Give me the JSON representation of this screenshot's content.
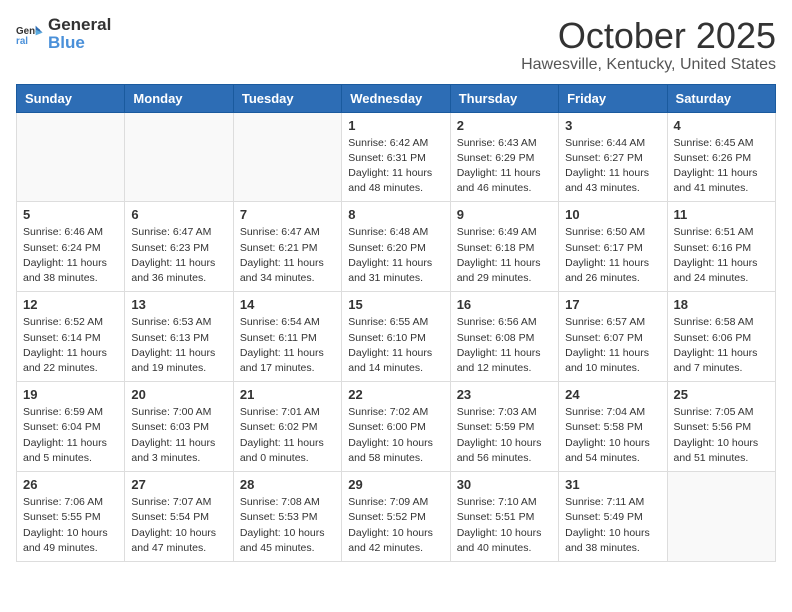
{
  "header": {
    "logo_general": "General",
    "logo_blue": "Blue",
    "month_title": "October 2025",
    "location": "Hawesville, Kentucky, United States"
  },
  "weekdays": [
    "Sunday",
    "Monday",
    "Tuesday",
    "Wednesday",
    "Thursday",
    "Friday",
    "Saturday"
  ],
  "weeks": [
    [
      {
        "day": "",
        "sunrise": "",
        "sunset": "",
        "daylight": ""
      },
      {
        "day": "",
        "sunrise": "",
        "sunset": "",
        "daylight": ""
      },
      {
        "day": "",
        "sunrise": "",
        "sunset": "",
        "daylight": ""
      },
      {
        "day": "1",
        "sunrise": "Sunrise: 6:42 AM",
        "sunset": "Sunset: 6:31 PM",
        "daylight": "Daylight: 11 hours and 48 minutes."
      },
      {
        "day": "2",
        "sunrise": "Sunrise: 6:43 AM",
        "sunset": "Sunset: 6:29 PM",
        "daylight": "Daylight: 11 hours and 46 minutes."
      },
      {
        "day": "3",
        "sunrise": "Sunrise: 6:44 AM",
        "sunset": "Sunset: 6:27 PM",
        "daylight": "Daylight: 11 hours and 43 minutes."
      },
      {
        "day": "4",
        "sunrise": "Sunrise: 6:45 AM",
        "sunset": "Sunset: 6:26 PM",
        "daylight": "Daylight: 11 hours and 41 minutes."
      }
    ],
    [
      {
        "day": "5",
        "sunrise": "Sunrise: 6:46 AM",
        "sunset": "Sunset: 6:24 PM",
        "daylight": "Daylight: 11 hours and 38 minutes."
      },
      {
        "day": "6",
        "sunrise": "Sunrise: 6:47 AM",
        "sunset": "Sunset: 6:23 PM",
        "daylight": "Daylight: 11 hours and 36 minutes."
      },
      {
        "day": "7",
        "sunrise": "Sunrise: 6:47 AM",
        "sunset": "Sunset: 6:21 PM",
        "daylight": "Daylight: 11 hours and 34 minutes."
      },
      {
        "day": "8",
        "sunrise": "Sunrise: 6:48 AM",
        "sunset": "Sunset: 6:20 PM",
        "daylight": "Daylight: 11 hours and 31 minutes."
      },
      {
        "day": "9",
        "sunrise": "Sunrise: 6:49 AM",
        "sunset": "Sunset: 6:18 PM",
        "daylight": "Daylight: 11 hours and 29 minutes."
      },
      {
        "day": "10",
        "sunrise": "Sunrise: 6:50 AM",
        "sunset": "Sunset: 6:17 PM",
        "daylight": "Daylight: 11 hours and 26 minutes."
      },
      {
        "day": "11",
        "sunrise": "Sunrise: 6:51 AM",
        "sunset": "Sunset: 6:16 PM",
        "daylight": "Daylight: 11 hours and 24 minutes."
      }
    ],
    [
      {
        "day": "12",
        "sunrise": "Sunrise: 6:52 AM",
        "sunset": "Sunset: 6:14 PM",
        "daylight": "Daylight: 11 hours and 22 minutes."
      },
      {
        "day": "13",
        "sunrise": "Sunrise: 6:53 AM",
        "sunset": "Sunset: 6:13 PM",
        "daylight": "Daylight: 11 hours and 19 minutes."
      },
      {
        "day": "14",
        "sunrise": "Sunrise: 6:54 AM",
        "sunset": "Sunset: 6:11 PM",
        "daylight": "Daylight: 11 hours and 17 minutes."
      },
      {
        "day": "15",
        "sunrise": "Sunrise: 6:55 AM",
        "sunset": "Sunset: 6:10 PM",
        "daylight": "Daylight: 11 hours and 14 minutes."
      },
      {
        "day": "16",
        "sunrise": "Sunrise: 6:56 AM",
        "sunset": "Sunset: 6:08 PM",
        "daylight": "Daylight: 11 hours and 12 minutes."
      },
      {
        "day": "17",
        "sunrise": "Sunrise: 6:57 AM",
        "sunset": "Sunset: 6:07 PM",
        "daylight": "Daylight: 11 hours and 10 minutes."
      },
      {
        "day": "18",
        "sunrise": "Sunrise: 6:58 AM",
        "sunset": "Sunset: 6:06 PM",
        "daylight": "Daylight: 11 hours and 7 minutes."
      }
    ],
    [
      {
        "day": "19",
        "sunrise": "Sunrise: 6:59 AM",
        "sunset": "Sunset: 6:04 PM",
        "daylight": "Daylight: 11 hours and 5 minutes."
      },
      {
        "day": "20",
        "sunrise": "Sunrise: 7:00 AM",
        "sunset": "Sunset: 6:03 PM",
        "daylight": "Daylight: 11 hours and 3 minutes."
      },
      {
        "day": "21",
        "sunrise": "Sunrise: 7:01 AM",
        "sunset": "Sunset: 6:02 PM",
        "daylight": "Daylight: 11 hours and 0 minutes."
      },
      {
        "day": "22",
        "sunrise": "Sunrise: 7:02 AM",
        "sunset": "Sunset: 6:00 PM",
        "daylight": "Daylight: 10 hours and 58 minutes."
      },
      {
        "day": "23",
        "sunrise": "Sunrise: 7:03 AM",
        "sunset": "Sunset: 5:59 PM",
        "daylight": "Daylight: 10 hours and 56 minutes."
      },
      {
        "day": "24",
        "sunrise": "Sunrise: 7:04 AM",
        "sunset": "Sunset: 5:58 PM",
        "daylight": "Daylight: 10 hours and 54 minutes."
      },
      {
        "day": "25",
        "sunrise": "Sunrise: 7:05 AM",
        "sunset": "Sunset: 5:56 PM",
        "daylight": "Daylight: 10 hours and 51 minutes."
      }
    ],
    [
      {
        "day": "26",
        "sunrise": "Sunrise: 7:06 AM",
        "sunset": "Sunset: 5:55 PM",
        "daylight": "Daylight: 10 hours and 49 minutes."
      },
      {
        "day": "27",
        "sunrise": "Sunrise: 7:07 AM",
        "sunset": "Sunset: 5:54 PM",
        "daylight": "Daylight: 10 hours and 47 minutes."
      },
      {
        "day": "28",
        "sunrise": "Sunrise: 7:08 AM",
        "sunset": "Sunset: 5:53 PM",
        "daylight": "Daylight: 10 hours and 45 minutes."
      },
      {
        "day": "29",
        "sunrise": "Sunrise: 7:09 AM",
        "sunset": "Sunset: 5:52 PM",
        "daylight": "Daylight: 10 hours and 42 minutes."
      },
      {
        "day": "30",
        "sunrise": "Sunrise: 7:10 AM",
        "sunset": "Sunset: 5:51 PM",
        "daylight": "Daylight: 10 hours and 40 minutes."
      },
      {
        "day": "31",
        "sunrise": "Sunrise: 7:11 AM",
        "sunset": "Sunset: 5:49 PM",
        "daylight": "Daylight: 10 hours and 38 minutes."
      },
      {
        "day": "",
        "sunrise": "",
        "sunset": "",
        "daylight": ""
      }
    ]
  ]
}
